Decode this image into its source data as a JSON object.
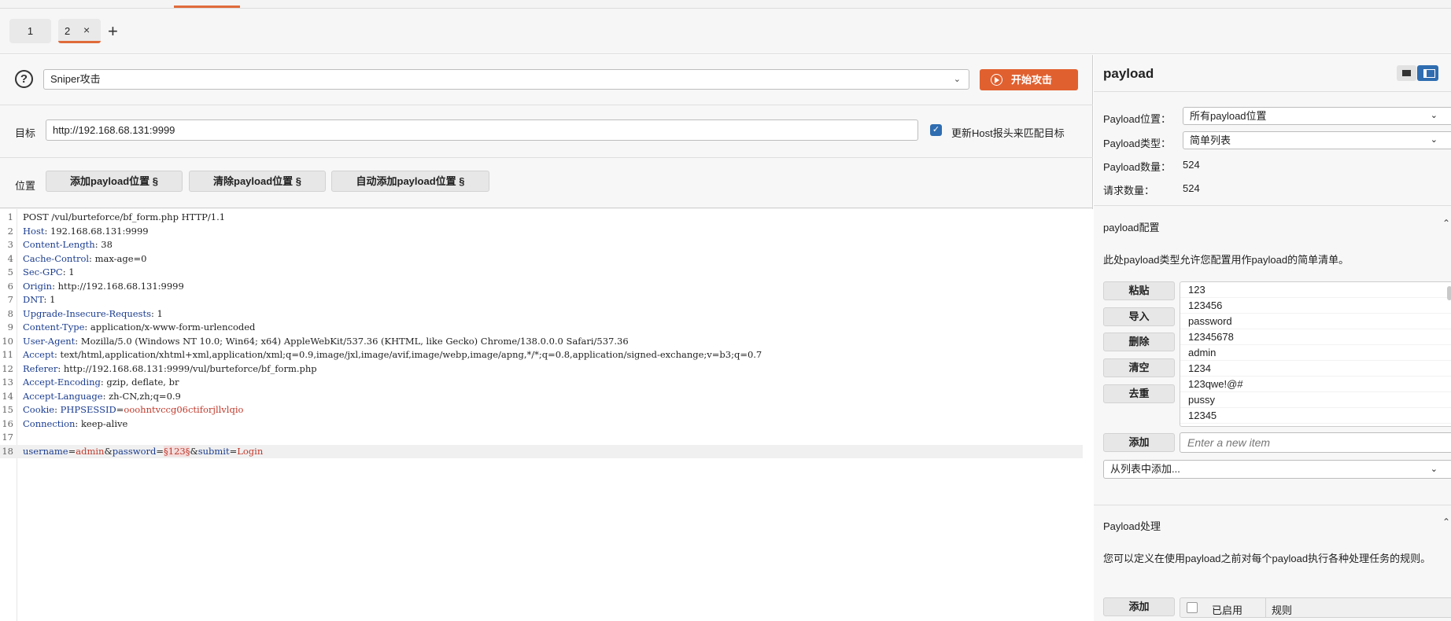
{
  "tabs": [
    {
      "label": "1"
    },
    {
      "label": "2",
      "close": "×"
    }
  ],
  "add_tab": "+",
  "toolbar": {
    "attack_type": "Sniper攻击",
    "start_attack": "开始攻击"
  },
  "target": {
    "label": "目标",
    "value": "http://192.168.68.131:9999",
    "update_host_label": "更新Host报头来匹配目标",
    "update_host_checked": true
  },
  "positions": {
    "label": "位置",
    "add_label": "添加payload位置 §",
    "clear_label": "清除payload位置 §",
    "auto_label": "自动添加payload位置 §"
  },
  "request": {
    "line_numbers": [
      "1",
      "2",
      "3",
      "4",
      "5",
      "6",
      "7",
      "8",
      "9",
      "10",
      "11",
      "12",
      "13",
      "14",
      "15",
      "16",
      "17",
      "18"
    ],
    "request_line": "POST /vul/burteforce/bf_form.php HTTP/1.1",
    "headers": [
      {
        "name": "Host",
        "value": " 192.168.68.131:9999"
      },
      {
        "name": "Content-Length",
        "value": " 38"
      },
      {
        "name": "Cache-Control",
        "value": " max-age=0"
      },
      {
        "name": "Sec-GPC",
        "value": " 1"
      },
      {
        "name": "Origin",
        "value": " http://192.168.68.131:9999"
      },
      {
        "name": "DNT",
        "value": " 1"
      },
      {
        "name": "Upgrade-Insecure-Requests",
        "value": " 1"
      },
      {
        "name": "Content-Type",
        "value": " application/x-www-form-urlencoded"
      },
      {
        "name": "User-Agent",
        "value": " Mozilla/5.0 (Windows NT 10.0; Win64; x64) AppleWebKit/537.36 (KHTML, like Gecko) Chrome/138.0.0.0 Safari/537.36"
      },
      {
        "name": "Accept",
        "value": " text/html,application/xhtml+xml,application/xml;q=0.9,image/jxl,image/avif,image/webp,image/apng,*/*;q=0.8,application/signed-exchange;v=b3;q=0.7"
      },
      {
        "name": "Referer",
        "value": " http://192.168.68.131:9999/vul/burteforce/bf_form.php"
      },
      {
        "name": "Accept-Encoding",
        "value": " gzip, deflate, br"
      },
      {
        "name": "Accept-Language",
        "value": " zh-CN,zh;q=0.9"
      }
    ],
    "cookie": {
      "name": "Cookie",
      "key": "PHPSESSID",
      "value": "ooohntvccg06ctiforjllvlqio"
    },
    "connection": {
      "name": "Connection",
      "value": " keep-alive"
    },
    "body": {
      "k1": "username",
      "v1": "admin",
      "k2": "password",
      "marked": "§123§",
      "k3": "submit",
      "v3": "Login"
    }
  },
  "payload_panel": {
    "title": "payload",
    "position_label": "Payload位置：",
    "position_value": "所有payload位置",
    "type_label": "Payload类型：",
    "type_value": "简单列表",
    "count_label": "Payload数量：",
    "count_value": "524",
    "request_label": "请求数量：",
    "request_value": "524"
  },
  "payload_config": {
    "heading": "payload配置",
    "description": "此处payload类型允许您配置用作payload的简单清单。",
    "buttons": {
      "paste": "粘贴",
      "load": "导入",
      "remove": "删除",
      "clear": "清空",
      "dedupe": "去重",
      "add": "添加"
    },
    "items": [
      "123",
      "123456",
      "password",
      "12345678",
      "admin",
      "1234",
      "123qwe!@#",
      "pussy",
      "12345"
    ],
    "new_item_placeholder": "Enter a new item",
    "add_from_list": "从列表中添加..."
  },
  "payload_processing": {
    "heading": "Payload处理",
    "description": "您可以定义在使用payload之前对每个payload执行各种处理任务的规则。",
    "add_label": "添加",
    "col_enabled": "已启用",
    "col_rule": "规则"
  }
}
